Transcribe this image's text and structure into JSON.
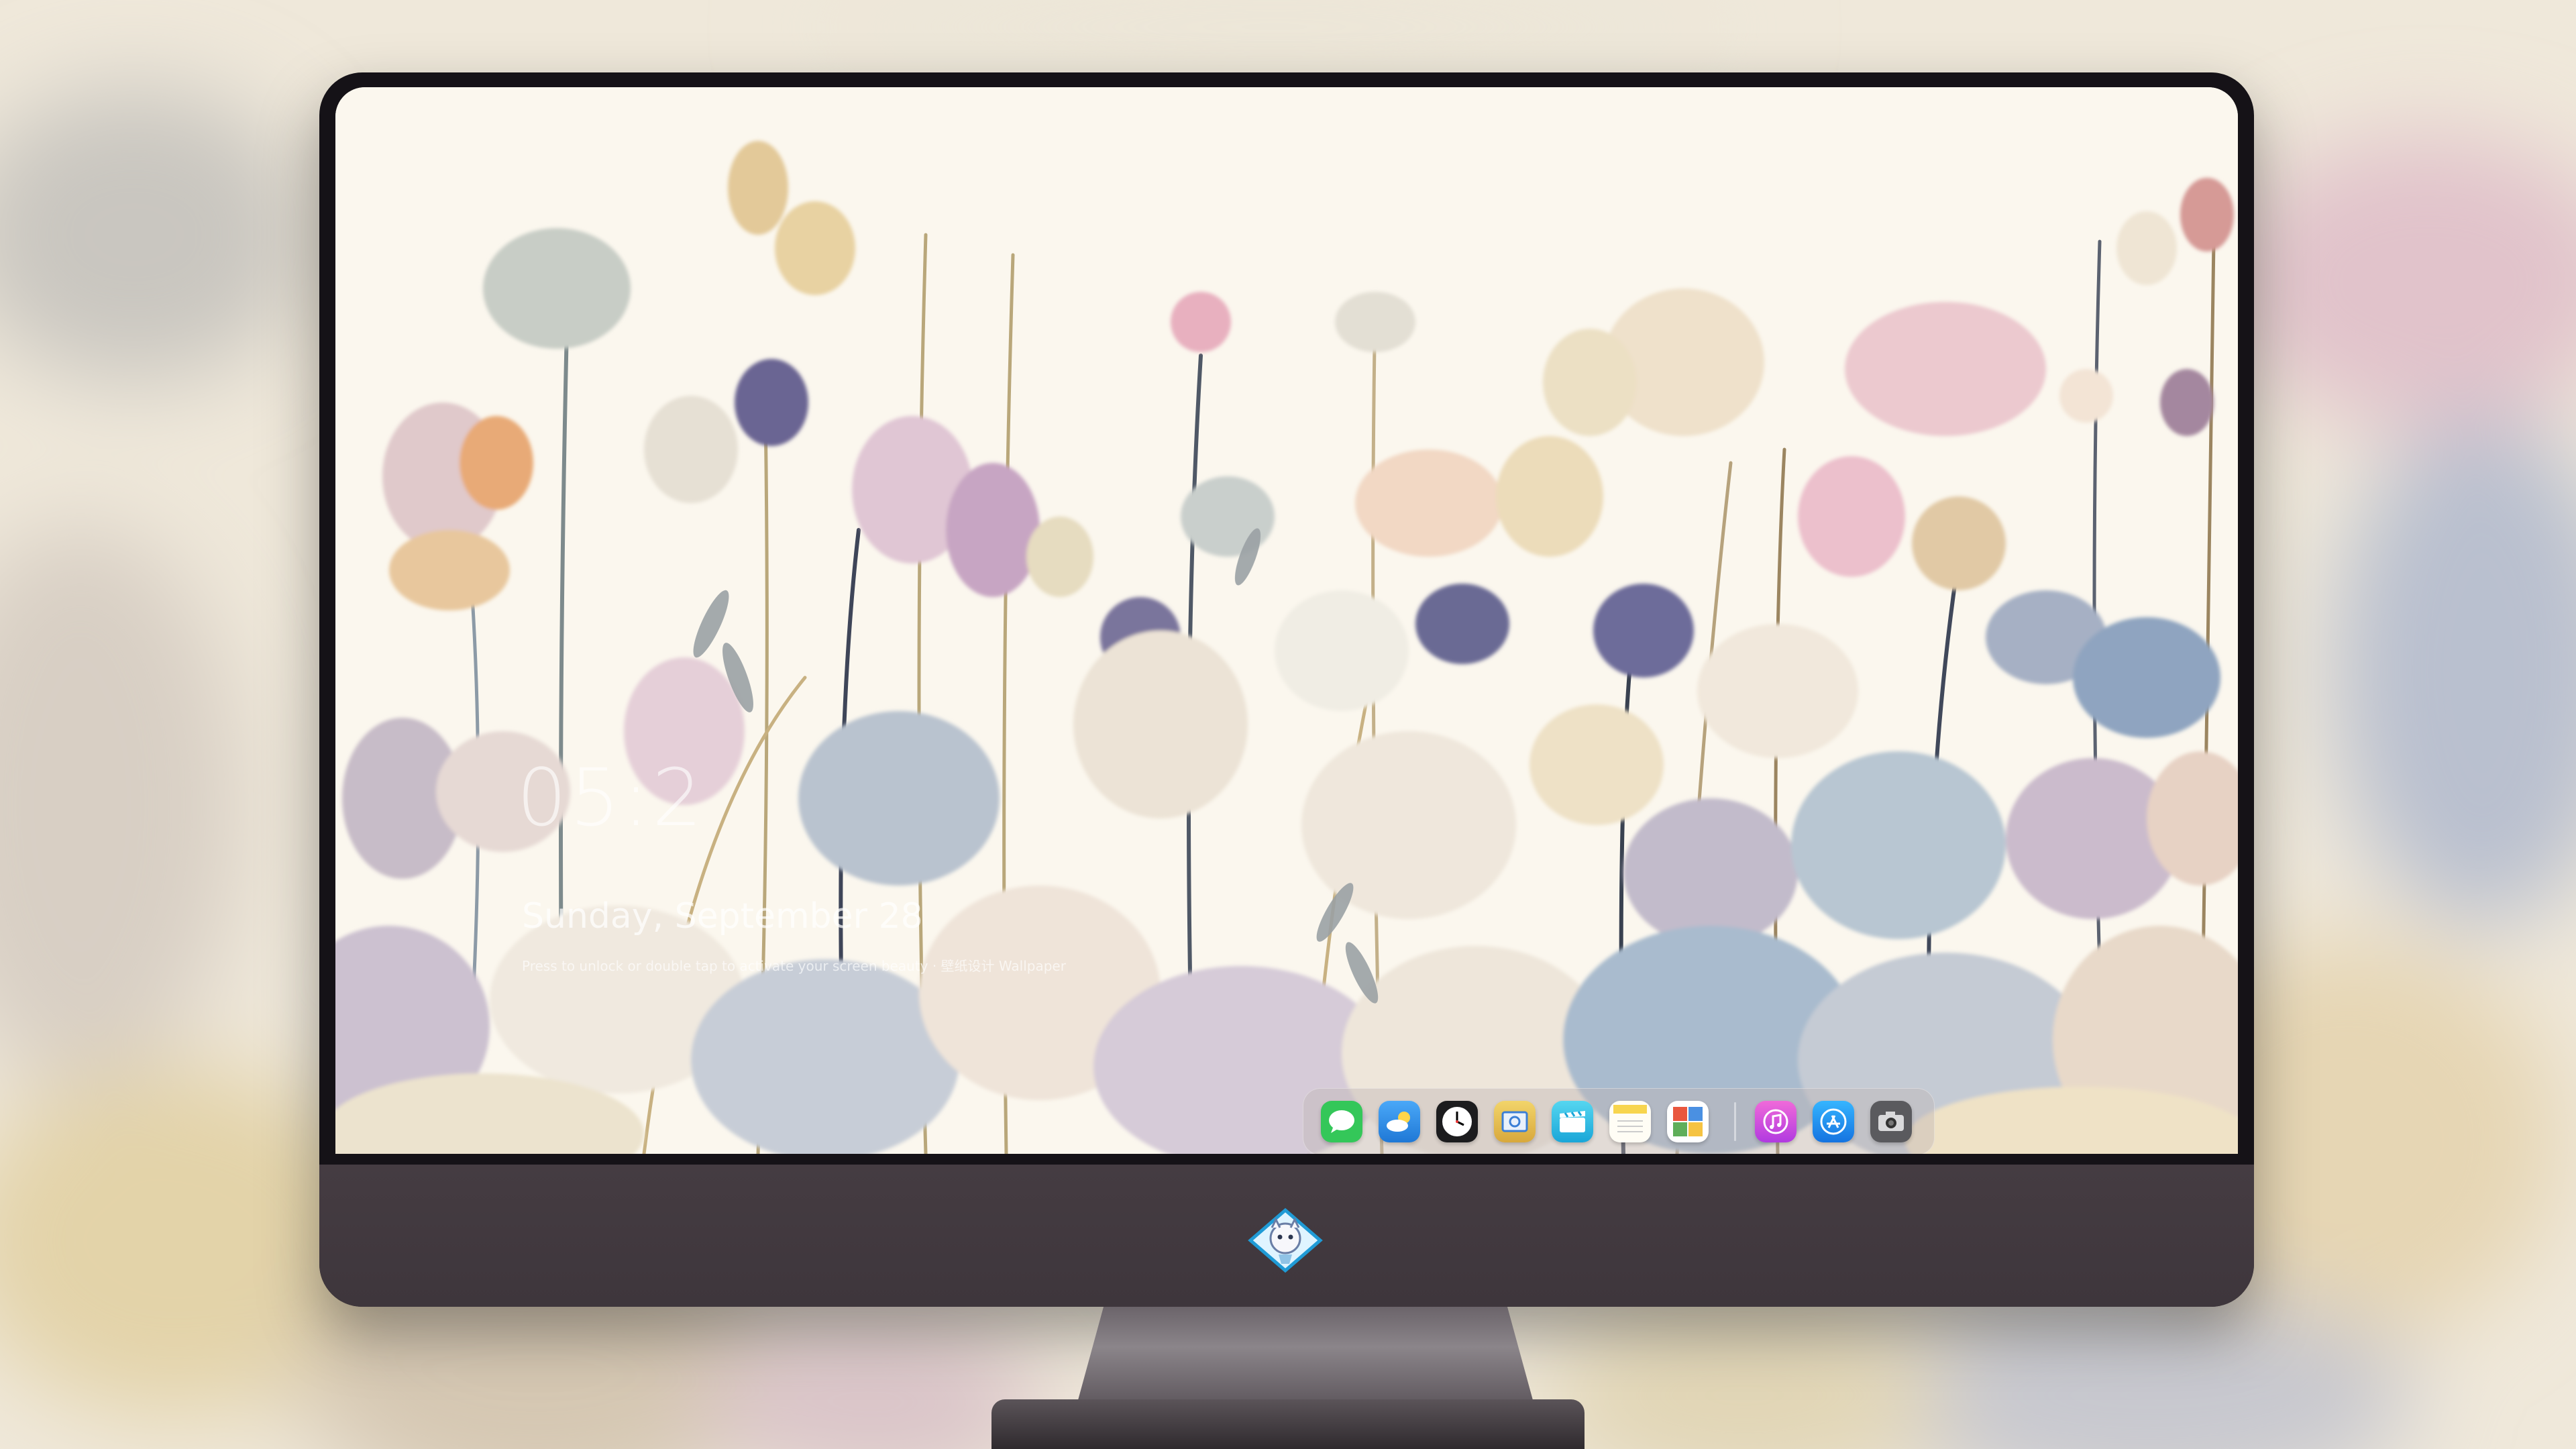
{
  "lock_screen": {
    "time": "05:2",
    "date": "Sunday, September 28",
    "hint": "Press to unlock or double tap to activate your screen beauty · 壁纸设计 Wallpaper"
  },
  "dock": {
    "apps": [
      {
        "name": "messages-icon",
        "color": "#34c759"
      },
      {
        "name": "weather-icon",
        "color": "#3a9df5"
      },
      {
        "name": "clock-icon",
        "color": "#1c1c1e"
      },
      {
        "name": "preview-icon",
        "color": "#e8c04a"
      },
      {
        "name": "clips-icon",
        "color": "#2fc6e6"
      },
      {
        "name": "notes-icon",
        "color": "#f7d54e"
      },
      {
        "name": "photo-booth-icon",
        "color": "#5fae5a"
      },
      {
        "name": "music-icon",
        "color": "#e84cd4"
      },
      {
        "name": "app-store-icon",
        "color": "#1d8ff2"
      },
      {
        "name": "camera-icon",
        "color": "#5a5a5e"
      }
    ]
  },
  "colors": {
    "wallpaper_bg": "#fbf7ee",
    "bezel": "#151217",
    "chin": "#433a40"
  }
}
